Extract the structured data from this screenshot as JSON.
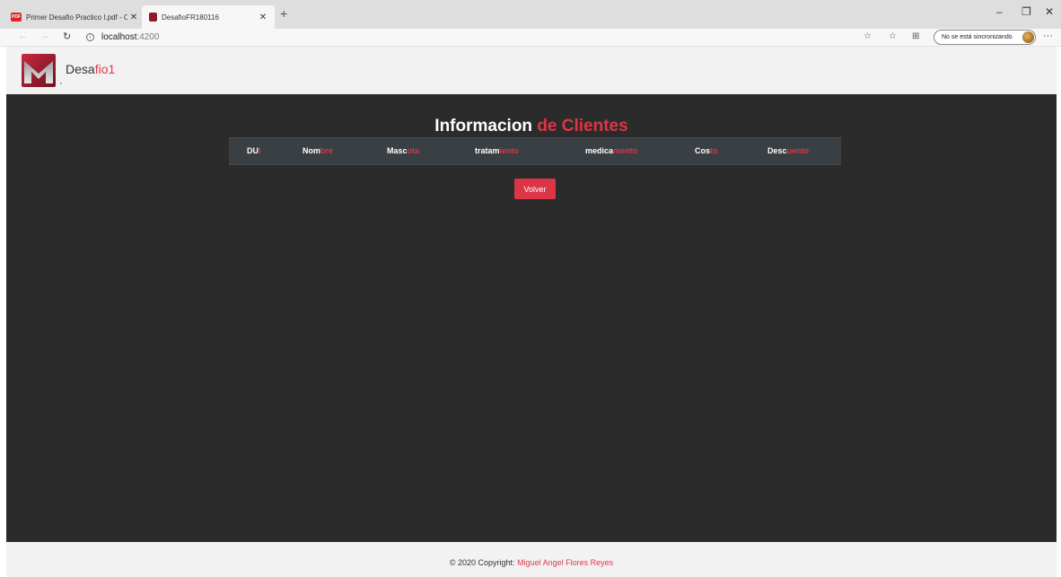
{
  "browser": {
    "tabs": [
      {
        "title": "Primer Desafio Practico I.pdf - O",
        "favicon": "pdf-icon",
        "favicon_text": "PDF"
      },
      {
        "title": "DesafioFR180116",
        "favicon": "app-logo-icon",
        "active": true
      }
    ],
    "new_tab": "+",
    "window_controls": {
      "minimize": "–",
      "restore": "❐",
      "close": "✕"
    },
    "nav": {
      "back": "←",
      "forward": "→",
      "reload": "↻"
    },
    "url_host": "localhost",
    "url_port": ":4200",
    "toolbar_icons": {
      "favorite": "☆",
      "favorites_bar": "☆",
      "collections": "⊞"
    },
    "sync_label": "No se está sincronizando",
    "more": "···"
  },
  "header": {
    "brand_main": "Desa",
    "brand_accent": "fio1"
  },
  "main": {
    "heading_main": "Informacion",
    "heading_accent": "de Clientes",
    "columns": [
      {
        "main": "DU",
        "accent": "I"
      },
      {
        "main": "Nom",
        "accent": "bre"
      },
      {
        "main": "Masc",
        "accent": "ota"
      },
      {
        "main": "tratam",
        "accent": "iento"
      },
      {
        "main": "medica",
        "accent": "mento"
      },
      {
        "main": "Cos",
        "accent": "to"
      },
      {
        "main": "Desc",
        "accent": "uento"
      }
    ],
    "back_button": "Volver"
  },
  "footer": {
    "copyright": "© 2020 Copyright:",
    "author": "Miguel Angel Flores Reyes"
  },
  "colors": {
    "accent": "#dc3545",
    "main_bg": "#2b2b2b",
    "table_header_bg": "#3a3f44"
  }
}
